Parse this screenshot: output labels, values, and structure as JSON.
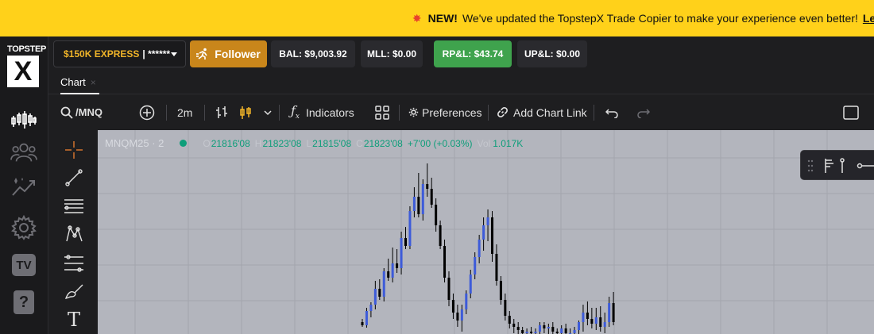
{
  "banner": {
    "new_label": "NEW!",
    "message": "We've updated the TopstepX Trade Copier to make your experience even better!",
    "link_text": "Lea"
  },
  "logo": {
    "brand": "TOPSTEP",
    "mark": "X"
  },
  "account": {
    "name": "$150K EXPRESS",
    "masked": "| ******",
    "follower_label": "Follower",
    "stats": [
      {
        "label": "BAL: $9,003.92"
      },
      {
        "label": "MLL: $0.00"
      },
      {
        "label": "RP&L: $43.74"
      },
      {
        "label": "UP&L: $0.00"
      }
    ]
  },
  "tabs": [
    {
      "label": "Chart",
      "close": "×"
    }
  ],
  "toolbar": {
    "symbol": "/MNQ",
    "interval": "2m",
    "indicators_label": "Indicators",
    "preferences_label": "Preferences",
    "add_chart_link_label": "Add Chart Link"
  },
  "sidebar_icons": [
    "chart-candles-icon",
    "users-icon",
    "analytics-icon",
    "gear-icon",
    "tv-icon",
    "help-icon"
  ],
  "tv_label": "TV",
  "help_label": "?",
  "drawing_tools": [
    "crosshair-icon",
    "trend-line-icon",
    "horizontal-lines-icon",
    "pattern-icon",
    "fib-icon",
    "brush-icon",
    "text-icon"
  ],
  "text_tool_label": "T",
  "legend": {
    "symbol": "MNQM25 · 2",
    "open_k": "O",
    "open_v": "21816'08",
    "high_k": "H",
    "high_v": "21823'08",
    "low_k": "L",
    "low_v": "21815'08",
    "close_k": "C",
    "close_v": "21823'08",
    "change": "+7'00 (+0.03%)",
    "vol_k": "Vol",
    "vol_v": "1.017K"
  },
  "colors": {
    "banner": "#ffd11a",
    "follower": "#c9861b",
    "rpl": "#3fa34d",
    "chart_bg": "#b3b5bd",
    "candle_up": "#3d5bd9",
    "candle_down": "#000000",
    "legend_value": "#0e9e7a"
  },
  "candles": [
    {
      "o": 8,
      "h": 12,
      "l": 2,
      "c": 4
    },
    {
      "o": 4,
      "h": 26,
      "l": 1,
      "c": 22
    },
    {
      "o": 22,
      "h": 33,
      "l": 14,
      "c": 30
    },
    {
      "o": 30,
      "h": 60,
      "l": 24,
      "c": 50
    },
    {
      "o": 50,
      "h": 62,
      "l": 36,
      "c": 40
    },
    {
      "o": 40,
      "h": 76,
      "l": 34,
      "c": 72
    },
    {
      "o": 72,
      "h": 88,
      "l": 60,
      "c": 64
    },
    {
      "o": 64,
      "h": 102,
      "l": 58,
      "c": 82
    },
    {
      "o": 82,
      "h": 100,
      "l": 70,
      "c": 76
    },
    {
      "o": 76,
      "h": 122,
      "l": 68,
      "c": 114
    },
    {
      "o": 114,
      "h": 128,
      "l": 100,
      "c": 104
    },
    {
      "o": 104,
      "h": 154,
      "l": 100,
      "c": 148
    },
    {
      "o": 148,
      "h": 178,
      "l": 140,
      "c": 166
    },
    {
      "o": 166,
      "h": 196,
      "l": 140,
      "c": 144
    },
    {
      "o": 144,
      "h": 188,
      "l": 136,
      "c": 182
    },
    {
      "o": 182,
      "h": 208,
      "l": 166,
      "c": 176
    },
    {
      "o": 176,
      "h": 190,
      "l": 152,
      "c": 156
    },
    {
      "o": 156,
      "h": 164,
      "l": 122,
      "c": 130
    },
    {
      "o": 130,
      "h": 136,
      "l": 100,
      "c": 104
    },
    {
      "o": 104,
      "h": 112,
      "l": 58,
      "c": 64
    },
    {
      "o": 64,
      "h": 72,
      "l": 28,
      "c": 36
    },
    {
      "o": 36,
      "h": 44,
      "l": 12,
      "c": 20
    },
    {
      "o": 20,
      "h": 30,
      "l": 2,
      "c": 10
    },
    {
      "o": 10,
      "h": 30,
      "l": -4,
      "c": 24
    },
    {
      "o": 24,
      "h": 48,
      "l": 18,
      "c": 44
    },
    {
      "o": 44,
      "h": 74,
      "l": 38,
      "c": 68
    },
    {
      "o": 68,
      "h": 96,
      "l": 62,
      "c": 90
    },
    {
      "o": 90,
      "h": 118,
      "l": 82,
      "c": 112
    },
    {
      "o": 112,
      "h": 140,
      "l": 98,
      "c": 130
    },
    {
      "o": 130,
      "h": 150,
      "l": 110,
      "c": 140
    },
    {
      "o": 140,
      "h": 148,
      "l": 84,
      "c": 94
    },
    {
      "o": 94,
      "h": 106,
      "l": 54,
      "c": 60
    },
    {
      "o": 60,
      "h": 66,
      "l": 30,
      "c": 36
    },
    {
      "o": 36,
      "h": 44,
      "l": 10,
      "c": 16
    },
    {
      "o": 16,
      "h": 22,
      "l": 0,
      "c": 6
    },
    {
      "o": 6,
      "h": 12,
      "l": -6,
      "c": 2
    },
    {
      "o": 2,
      "h": 8,
      "l": -8,
      "c": -2
    },
    {
      "o": -2,
      "h": 2,
      "l": -8,
      "c": -6
    },
    {
      "o": -6,
      "h": 0,
      "l": -8,
      "c": -4
    },
    {
      "o": -4,
      "h": 2,
      "l": -8,
      "c": -6
    },
    {
      "o": -6,
      "h": 0,
      "l": -8,
      "c": -4
    },
    {
      "o": -4,
      "h": 8,
      "l": -8,
      "c": 4
    },
    {
      "o": 4,
      "h": 8,
      "l": -6,
      "c": 0
    },
    {
      "o": 0,
      "h": 6,
      "l": -8,
      "c": 2
    },
    {
      "o": 2,
      "h": 8,
      "l": -8,
      "c": -4
    },
    {
      "o": -4,
      "h": 0,
      "l": -8,
      "c": -6
    },
    {
      "o": -6,
      "h": 4,
      "l": -8,
      "c": 0
    },
    {
      "o": 0,
      "h": 6,
      "l": -8,
      "c": -6
    },
    {
      "o": -6,
      "h": 0,
      "l": -8,
      "c": -6
    },
    {
      "o": -6,
      "h": 2,
      "l": -8,
      "c": -2
    },
    {
      "o": -2,
      "h": 10,
      "l": -8,
      "c": 8
    },
    {
      "o": 8,
      "h": 30,
      "l": -4,
      "c": 20
    },
    {
      "o": 20,
      "h": 34,
      "l": 4,
      "c": 12
    },
    {
      "o": 12,
      "h": 26,
      "l": 0,
      "c": 6
    },
    {
      "o": 6,
      "h": 26,
      "l": -2,
      "c": 14
    },
    {
      "o": 14,
      "h": 28,
      "l": -4,
      "c": 2
    },
    {
      "o": 2,
      "h": 20,
      "l": -6,
      "c": 8
    },
    {
      "o": 8,
      "h": 40,
      "l": 2,
      "c": 32
    },
    {
      "o": 32,
      "h": 46,
      "l": 4,
      "c": 8
    }
  ]
}
